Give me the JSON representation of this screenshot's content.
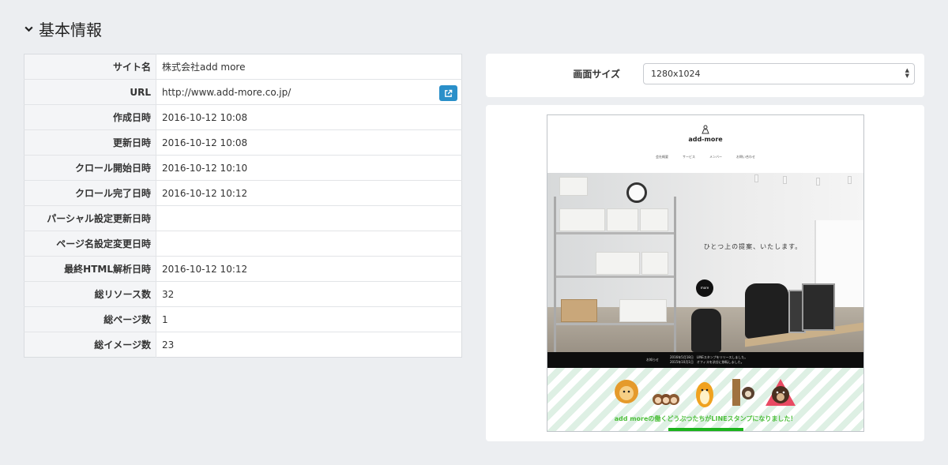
{
  "section": {
    "title": "基本情報",
    "icon": "chevron-down-icon"
  },
  "info": {
    "rows": [
      {
        "label": "サイト名",
        "value": "株式会社add more"
      },
      {
        "label": "URL",
        "value": "http://www.add-more.co.jp/"
      },
      {
        "label": "作成日時",
        "value": "2016-10-12 10:08"
      },
      {
        "label": "更新日時",
        "value": "2016-10-12 10:08"
      },
      {
        "label": "クロール開始日時",
        "value": "2016-10-12 10:10"
      },
      {
        "label": "クロール完了日時",
        "value": "2016-10-12 10:12"
      },
      {
        "label": "パーシャル設定更新日時",
        "value": ""
      },
      {
        "label": "ページ名設定変更日時",
        "value": ""
      },
      {
        "label": "最終HTML解析日時",
        "value": "2016-10-12 10:12"
      },
      {
        "label": "総リソース数",
        "value": "32"
      },
      {
        "label": "総ページ数",
        "value": "1"
      },
      {
        "label": "総イメージ数",
        "value": "23"
      }
    ],
    "external_link_icon": "external-link-icon",
    "accent_color": "#2a8fc9"
  },
  "screen_size": {
    "label": "画面サイズ",
    "selected": "1280x1024"
  },
  "preview": {
    "logo_text": "add-more",
    "nav": [
      "会社概要",
      "サービス",
      "メンバー",
      "お問い合わせ"
    ],
    "tagline": "ひとつ上の提案、いたします。",
    "more_button": "more",
    "news_label": "お知らせ",
    "news_lines": [
      "2016年5月18日　LINEスタンプをリリースしました。",
      "2015年10月1日　オフィスを渋谷に移転しました。"
    ],
    "banner_text": "add moreの働くどうぶつたちがLINEスタンプになりました！"
  }
}
